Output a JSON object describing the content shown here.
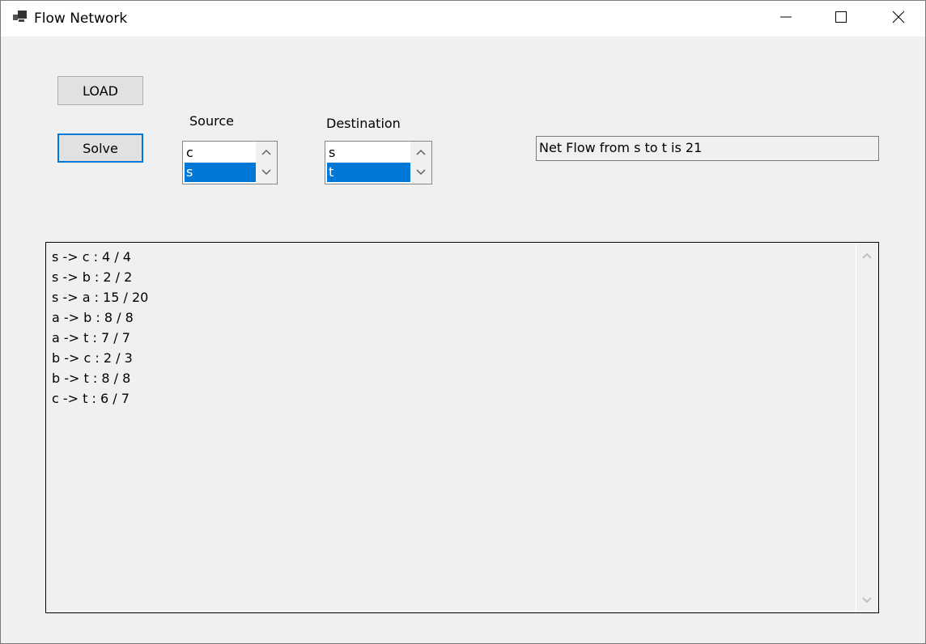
{
  "window": {
    "title": "Flow Network",
    "icon": "app-window-icon",
    "controls": [
      "minimize-icon",
      "maximize-icon",
      "close-icon"
    ]
  },
  "toolbar": {
    "load_label": "LOAD",
    "solve_label": "Solve"
  },
  "source": {
    "label": "Source",
    "items": [
      "c",
      "s"
    ],
    "selected": "s"
  },
  "destination": {
    "label": "Destination",
    "items": [
      "s",
      "t"
    ],
    "selected": "t"
  },
  "result": {
    "text": "Net Flow from s to t is 21"
  },
  "output": {
    "lines": [
      "s -> c : 4 / 4",
      "s -> b : 2 / 2",
      "s -> a : 15 / 20",
      "a -> b : 8 / 8",
      "a -> t : 7 / 7",
      "b -> c : 2 / 3",
      "b -> t : 8 / 8",
      "c -> t : 6 / 7"
    ]
  },
  "colors": {
    "accent": "#0078d7",
    "selection_text": "#ffffff",
    "background": "#f0f0f0"
  }
}
